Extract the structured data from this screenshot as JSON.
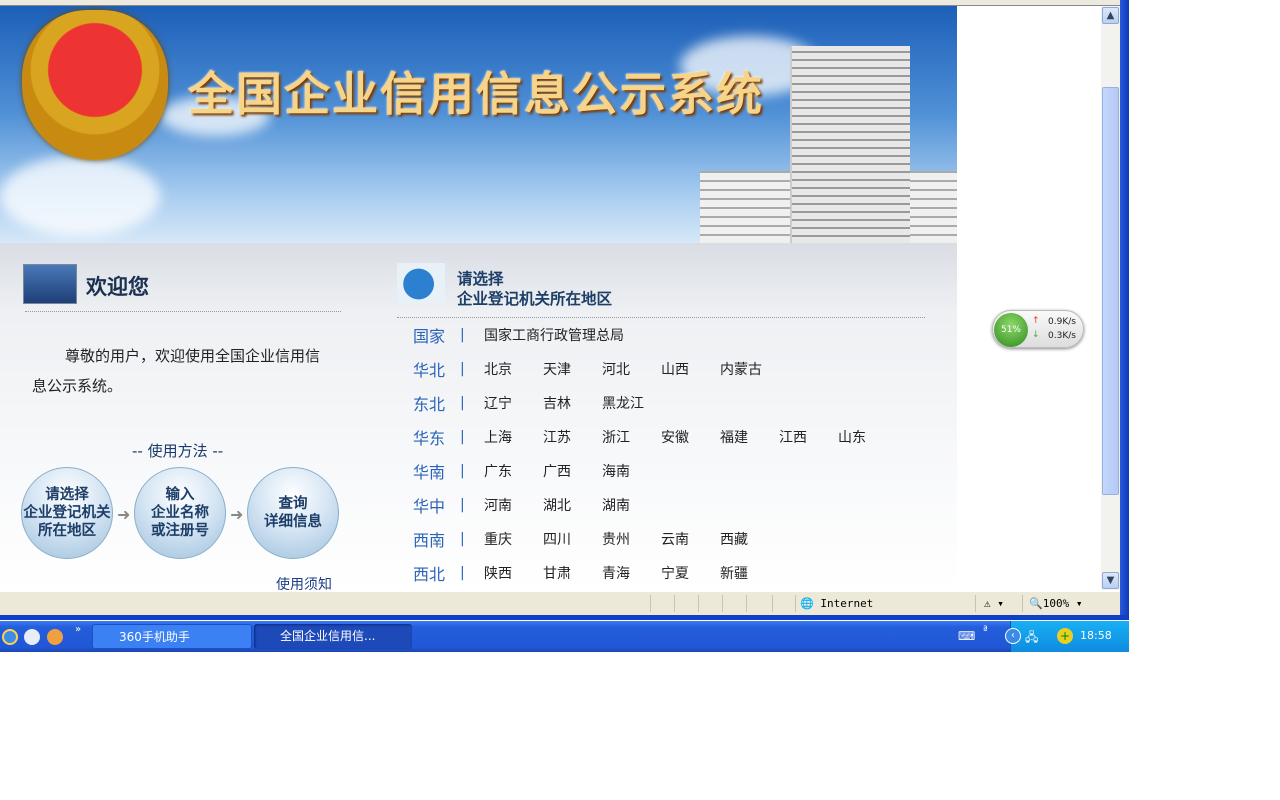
{
  "header": {
    "title": "全国企业信用信息公示系统"
  },
  "welcome": {
    "title": "欢迎您",
    "greeting": "尊敬的用户，欢迎使用全国企业信用信息公示系统。",
    "howto": "-- 使用方法 --",
    "steps": [
      "请选择\n企业登记机关\n所在地区",
      "输入\n企业名称\n或注册号",
      "查询\n详细信息"
    ],
    "notice": "使用须知"
  },
  "regions": {
    "heading_line1": "请选择",
    "heading_line2": "企业登记机关所在地区",
    "rows": [
      {
        "name": "国家",
        "cities": [
          "国家工商行政管理总局"
        ]
      },
      {
        "name": "华北",
        "cities": [
          "北京",
          "天津",
          "河北",
          "山西",
          "内蒙古"
        ]
      },
      {
        "name": "东北",
        "cities": [
          "辽宁",
          "吉林",
          "黑龙江"
        ]
      },
      {
        "name": "华东",
        "cities": [
          "上海",
          "江苏",
          "浙江",
          "安徽",
          "福建",
          "江西",
          "山东"
        ]
      },
      {
        "name": "华南",
        "cities": [
          "广东",
          "广西",
          "海南"
        ]
      },
      {
        "name": "华中",
        "cities": [
          "河南",
          "湖北",
          "湖南"
        ]
      },
      {
        "name": "西南",
        "cities": [
          "重庆",
          "四川",
          "贵州",
          "云南",
          "西藏"
        ]
      },
      {
        "name": "西北",
        "cities": [
          "陕西",
          "甘肃",
          "青海",
          "宁夏",
          "新疆"
        ]
      }
    ]
  },
  "net_widget": {
    "percent": "51%",
    "up": "0.9K/s",
    "down": "0.3K/s"
  },
  "statusbar": {
    "zone": "Internet",
    "zoom": "100%"
  },
  "taskbar": {
    "tasks": [
      "360手机助手",
      "全国企业信用信..."
    ],
    "clock": "18:58"
  }
}
